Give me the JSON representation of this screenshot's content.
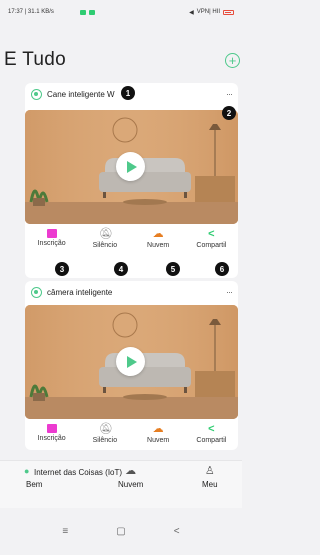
{
  "status": {
    "time_speed": "17:37 | 31.1 KB/s",
    "network": "VPN| HII"
  },
  "header": {
    "title": "E Tudo",
    "add_icon": "plus-circle-icon"
  },
  "cards": [
    {
      "name": "Cane inteligente W",
      "more": "···",
      "actions": [
        {
          "label": "Inscrição",
          "icon": "subscription-icon"
        },
        {
          "label": "Silêncio",
          "icon": "bell-mute-icon"
        },
        {
          "label": "Nuvem",
          "icon": "cloud-icon"
        },
        {
          "label": "Compartil",
          "icon": "share-icon"
        }
      ]
    },
    {
      "name": "câmera inteligente",
      "more": "···",
      "actions": [
        {
          "label": "Inscrição",
          "icon": "subscription-icon"
        },
        {
          "label": "Silêncio",
          "icon": "bell-mute-icon"
        },
        {
          "label": "Nuvem",
          "icon": "cloud-icon"
        },
        {
          "label": "Compartil",
          "icon": "share-icon"
        }
      ]
    }
  ],
  "markers": [
    "1",
    "2",
    "3",
    "4",
    "5",
    "6"
  ],
  "bottom_nav": {
    "iot_label": "Internet das Coisas (IoT)",
    "items": [
      {
        "label": "Bem",
        "icon": "home-icon"
      },
      {
        "label": "Nuvem",
        "icon": "cloud-icon"
      },
      {
        "label": "Meu",
        "icon": "person-icon"
      }
    ]
  },
  "system_nav": {
    "menu": "≡",
    "home": "▢",
    "back": "<"
  },
  "colors": {
    "accent": "#4ec98b",
    "subscription": "#ec3bd0",
    "cloud": "#e67e22",
    "share": "#2ecc71"
  }
}
